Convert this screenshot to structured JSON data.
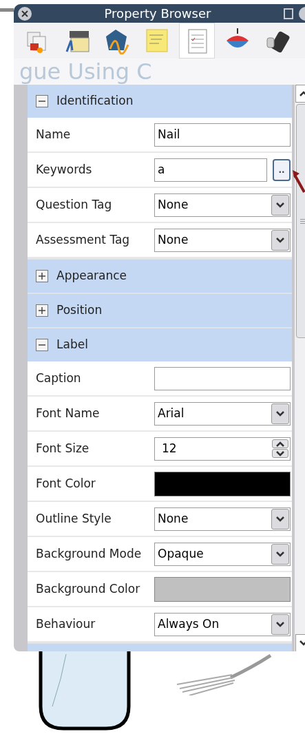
{
  "window": {
    "title": "Property Browser"
  },
  "toolbar": [
    {
      "selected": false
    },
    {
      "selected": false
    },
    {
      "selected": false
    },
    {
      "selected": false
    },
    {
      "selected": true
    },
    {
      "selected": false
    },
    {
      "selected": false
    }
  ],
  "background_text": "gue Using C",
  "sections": [
    {
      "title": "Identification",
      "expanded": true,
      "properties": [
        {
          "kind": "text",
          "label": "Name",
          "value": "Nail"
        },
        {
          "kind": "text_button",
          "label": "Keywords",
          "value": "a",
          "button": ".."
        },
        {
          "kind": "select",
          "label": "Question Tag",
          "value": "None"
        },
        {
          "kind": "select",
          "label": "Assessment Tag",
          "value": "None"
        }
      ]
    },
    {
      "title": "Appearance",
      "expanded": false
    },
    {
      "title": "Position",
      "expanded": false
    },
    {
      "title": "Label",
      "expanded": true,
      "properties": [
        {
          "kind": "text",
          "label": "Caption"
        },
        {
          "kind": "select",
          "label": "Font Name",
          "value": "Arial"
        },
        {
          "kind": "spinner",
          "label": "Font Size",
          "value": "12"
        },
        {
          "kind": "color",
          "label": "Font Color",
          "color": "#000000"
        },
        {
          "kind": "select",
          "label": "Outline Style",
          "value": "None"
        },
        {
          "kind": "select",
          "label": "Background Mode",
          "value": "Opaque"
        },
        {
          "kind": "color",
          "label": "Background Color",
          "color": "#c0c0c0"
        },
        {
          "kind": "select",
          "label": "Behaviour",
          "value": "Always On"
        }
      ]
    }
  ]
}
